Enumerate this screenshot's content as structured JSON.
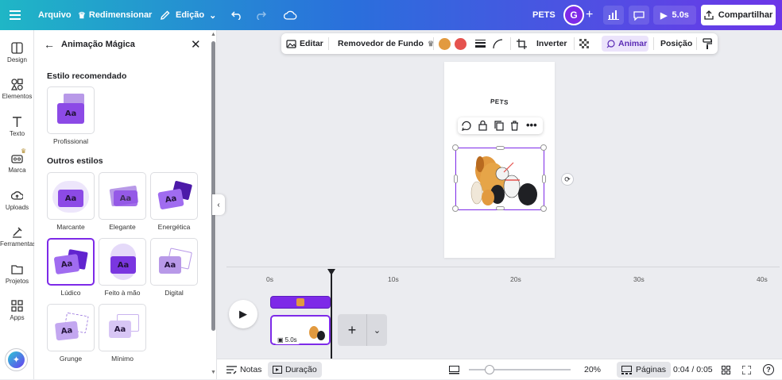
{
  "topbar": {
    "menu_file": "Arquivo",
    "menu_resize": "Redimensionar",
    "menu_edit": "Edição",
    "doc_title": "PETS",
    "avatar_initial": "G",
    "play_time": "5.0s",
    "share_label": "Compartilhar"
  },
  "rail": {
    "items": [
      {
        "label": "Design",
        "icon": "design-icon"
      },
      {
        "label": "Elementos",
        "icon": "elements-icon"
      },
      {
        "label": "Texto",
        "icon": "text-icon"
      },
      {
        "label": "Marca",
        "icon": "brand-icon"
      },
      {
        "label": "Uploads",
        "icon": "upload-icon"
      },
      {
        "label": "Ferramentas",
        "icon": "tools-icon"
      },
      {
        "label": "Projetos",
        "icon": "folder-icon"
      },
      {
        "label": "Apps",
        "icon": "apps-icon"
      }
    ]
  },
  "panel": {
    "title": "Animação Mágica",
    "recommended_heading": "Estilo recomendado",
    "recommended": {
      "label": "Profissional"
    },
    "other_heading": "Outros estilos",
    "styles": [
      {
        "label": "Marcante"
      },
      {
        "label": "Elegante"
      },
      {
        "label": "Energética"
      },
      {
        "label": "Lúdico",
        "selected": true
      },
      {
        "label": "Feito à mão"
      },
      {
        "label": "Digital"
      },
      {
        "label": "Grunge"
      },
      {
        "label": "Mínimo"
      }
    ],
    "card_glyph": "Aa"
  },
  "context_bar": {
    "edit": "Editar",
    "bg_remover": "Removedor de Fundo",
    "color1": "#e29a3f",
    "color2": "#e5524e",
    "invert": "Inverter",
    "animate": "Animar",
    "position": "Posição"
  },
  "canvas": {
    "page_text": "PETS"
  },
  "timeline": {
    "ticks": [
      "0s",
      "10s",
      "20s",
      "30s",
      "40s"
    ],
    "clip_duration": "5.0s"
  },
  "bottombar": {
    "notes": "Notas",
    "duration": "Duração",
    "zoom": "20%",
    "pages": "Páginas",
    "time": "0:04 / 0:05"
  },
  "colors": {
    "accent": "#7d2ae8",
    "gradient_start": "#1fb6c6",
    "gradient_end": "#6d36e8"
  }
}
